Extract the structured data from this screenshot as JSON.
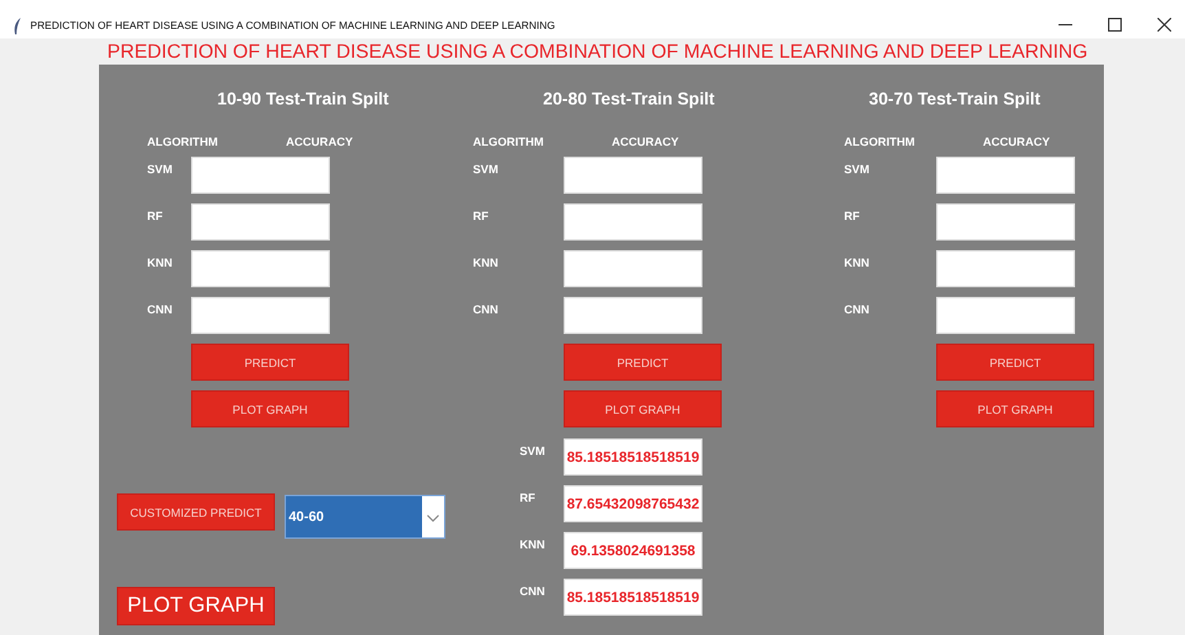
{
  "window": {
    "title": "PREDICTION OF HEART DISEASE USING A COMBINATION OF MACHINE LEARNING AND DEEP LEARNING"
  },
  "heading": "PREDICTION OF HEART DISEASE USING A COMBINATION OF MACHINE LEARNING AND DEEP LEARNING",
  "splits": [
    {
      "title": "10-90 Test-Train Spilt",
      "column_labels": [
        "ALGORITHM",
        "ACCURACY"
      ],
      "rows": [
        {
          "algorithm": "SVM"
        },
        {
          "algorithm": "RF"
        },
        {
          "algorithm": "KNN"
        },
        {
          "algorithm": "CNN"
        }
      ],
      "buttons": [
        "PREDICT",
        "PLOT GRAPH"
      ]
    },
    {
      "title": "20-80 Test-Train Spilt",
      "column_labels": [
        "ALGORITHM",
        "ACCURACY"
      ],
      "rows": [
        {
          "algorithm": "SVM"
        },
        {
          "algorithm": "RF"
        },
        {
          "algorithm": "KNN"
        },
        {
          "algorithm": "CNN"
        }
      ],
      "buttons": [
        "PREDICT",
        "PLOT GRAPH"
      ]
    },
    {
      "title": "30-70 Test-Train Spilt",
      "column_labels": [
        "ALGORITHM",
        "ACCURACY"
      ],
      "rows": [
        {
          "algorithm": "SVM"
        },
        {
          "algorithm": "RF"
        },
        {
          "algorithm": "KNN"
        },
        {
          "algorithm": "CNN"
        }
      ],
      "buttons": [
        "PREDICT",
        "PLOT GRAPH"
      ]
    }
  ],
  "customized": {
    "button": "CUSTOMIZED PREDICT",
    "split_select": {
      "value": "40-60"
    },
    "plot_button": "PLOT GRAPH"
  },
  "results": [
    {
      "algorithm": "SVM",
      "accuracy": "85.18518518518519"
    },
    {
      "algorithm": "RF",
      "accuracy": "87.65432098765432"
    },
    {
      "algorithm": "KNN",
      "accuracy": "69.1358024691358"
    },
    {
      "algorithm": "CNN",
      "accuracy": "85.18518518518519"
    }
  ]
}
